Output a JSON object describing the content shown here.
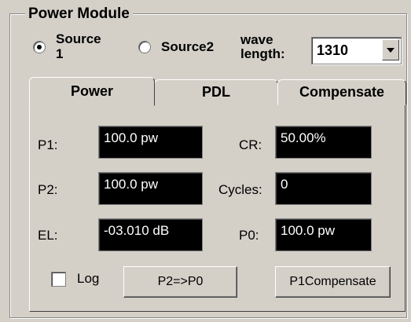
{
  "group": {
    "title": "Power Module"
  },
  "source": {
    "source1_label_line1": "Source",
    "source1_label_line2": "1",
    "source2_label": "Source2",
    "selected": "Source 1"
  },
  "wavelength": {
    "label_line1": "wave",
    "label_line2": "length:",
    "value": "1310"
  },
  "tabs": [
    {
      "label": "Power",
      "active": true
    },
    {
      "label": "PDL",
      "active": false
    },
    {
      "label": "Compensate",
      "active": false
    }
  ],
  "fields": {
    "p1": {
      "label": "P1:",
      "value": "100.0 pw"
    },
    "p2": {
      "label": "P2:",
      "value": "100.0 pw"
    },
    "el": {
      "label": "EL:",
      "value": "-03.010 dB"
    },
    "cr": {
      "label": "CR:",
      "value": "50.00%"
    },
    "cycles": {
      "label": "Cycles:",
      "value": "0"
    },
    "p0": {
      "label": "P0:",
      "value": "100.0 pw"
    }
  },
  "log": {
    "label": "Log",
    "checked": false
  },
  "buttons": {
    "p2_to_p0": "P2=>P0",
    "p1_compensate": "P1Compensate"
  },
  "colors": {
    "face": "#d4d0c8",
    "display_bg": "#000000",
    "display_fg": "#ffffff"
  }
}
